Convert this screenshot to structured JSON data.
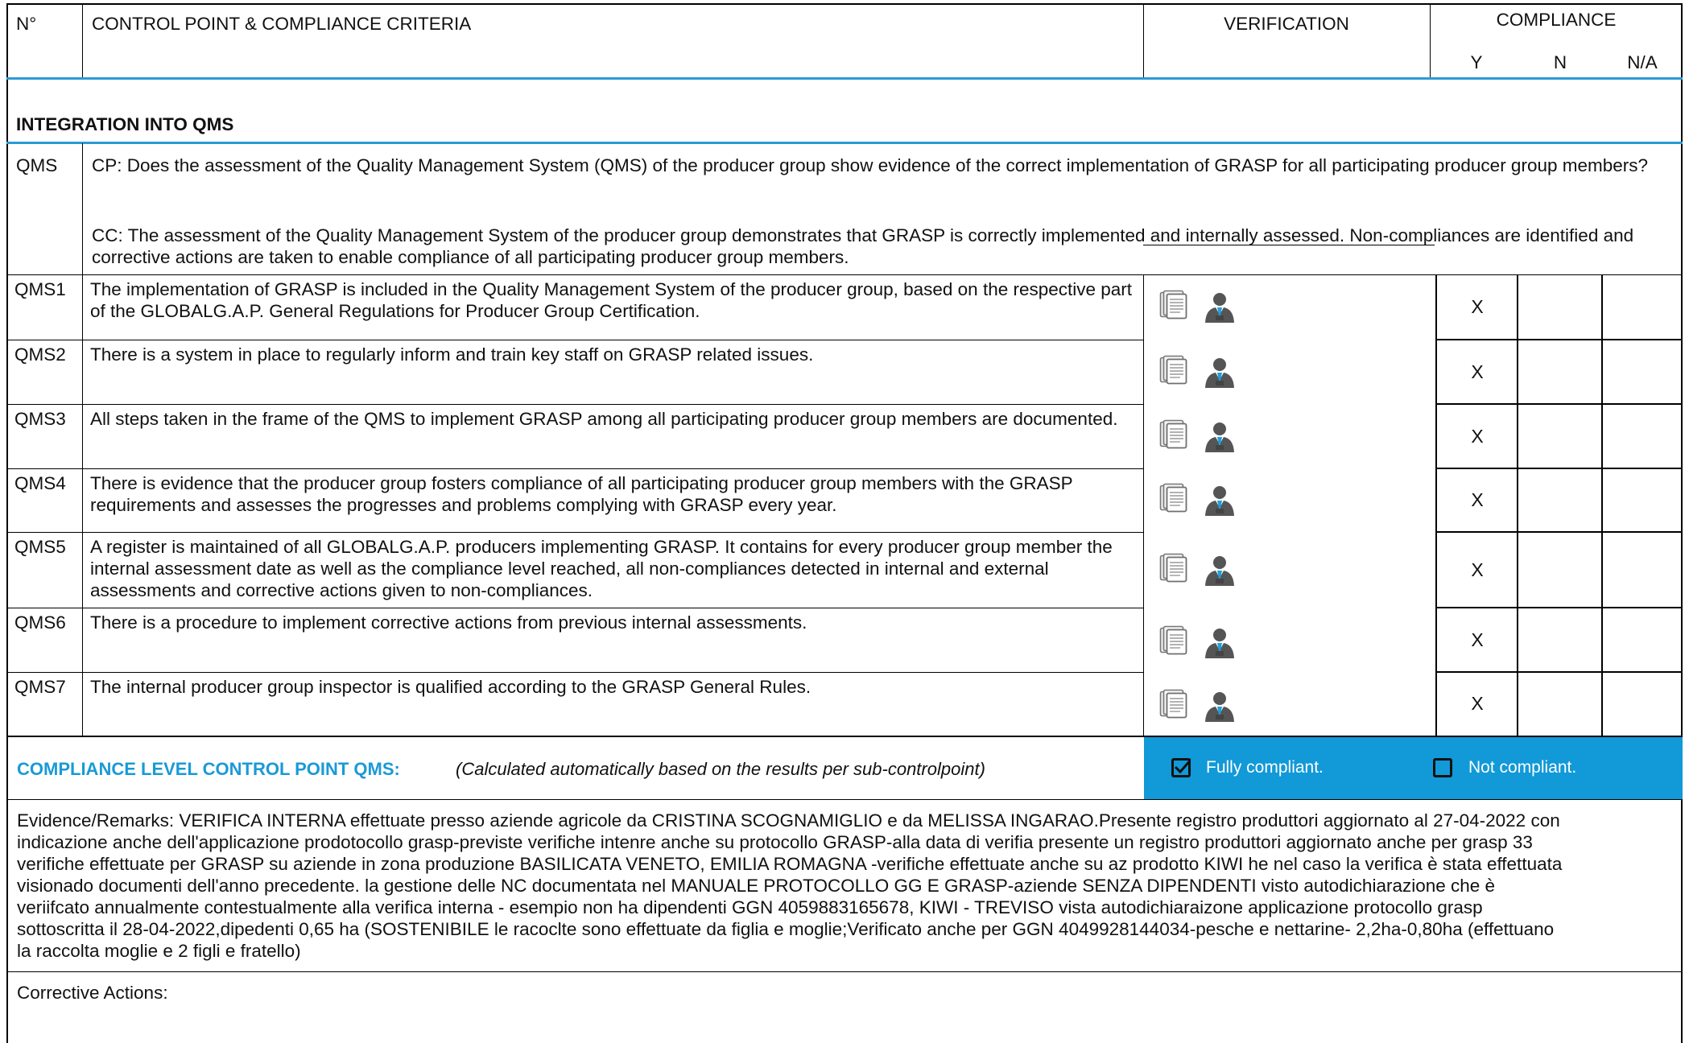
{
  "header": {
    "no": "N°",
    "criteria": "CONTROL POINT & COMPLIANCE CRITERIA",
    "verification": "VERIFICATION",
    "compliance": "COMPLIANCE",
    "y": "Y",
    "n": "N",
    "na": "N/A"
  },
  "section": {
    "title": "INTEGRATION INTO QMS"
  },
  "qms": {
    "code": "QMS",
    "cp": "CP: Does the assessment of the Quality Management System (QMS) of the producer group show evidence of the correct implementation of GRASP for all participating producer group members?",
    "cc": "CC: The assessment of the Quality Management System of the producer group demonstrates that GRASP is correctly implemented and internally assessed. Non-compliances are identified and corrective actions are taken to enable compliance of all participating producer group members."
  },
  "rows": [
    {
      "code": "QMS1",
      "text": "The implementation of GRASP is included in the Quality Management System of the producer group, based on the respective part of the GLOBALG.A.P. General Regulations for Producer Group Certification.",
      "y": "X",
      "n": "",
      "na": ""
    },
    {
      "code": "QMS2",
      "text": "There is a system in place to regularly inform and train key staff on GRASP related issues.",
      "y": "X",
      "n": "",
      "na": ""
    },
    {
      "code": "QMS3",
      "text": "All steps taken in the frame of the QMS to implement GRASP among all participating producer group members are documented.",
      "y": "X",
      "n": "",
      "na": ""
    },
    {
      "code": "QMS4",
      "text": "There is evidence that the producer group fosters compliance of all participating producer group members with the GRASP requirements and assesses the progresses and problems complying with GRASP every year.",
      "y": "X",
      "n": "",
      "na": ""
    },
    {
      "code": "QMS5",
      "text": "A register is maintained of all GLOBALG.A.P. producers implementing GRASP. It contains for every producer group member the internal assessment date as well as the compliance level reached, all non-compliances detected in internal and external assessments and corrective actions given to non-compliances.",
      "y": "X",
      "n": "",
      "na": ""
    },
    {
      "code": "QMS6",
      "text": "There is a procedure to implement corrective actions from previous internal assessments.",
      "y": "X",
      "n": "",
      "na": ""
    },
    {
      "code": "QMS7",
      "text": "The internal producer group inspector is qualified according to the GRASP General Rules.",
      "y": "X",
      "n": "",
      "na": ""
    }
  ],
  "compliance_level": {
    "label": "COMPLIANCE LEVEL CONTROL POINT QMS:",
    "note": "(Calculated automatically based on the results per sub-controlpoint)",
    "fully": "Fully compliant.",
    "not": "Not compliant.",
    "fully_checked": true,
    "not_checked": false
  },
  "evidence": {
    "lines": [
      "Evidence/Remarks: VERIFICA INTERNA effettuate presso aziende agricole da CRISTINA SCOGNAMIGLIO e da MELISSA INGARAO.Presente registro produttori aggiornato al 27-04-2022 con",
      "indicazione anche dell'applicazione prodotocollo grasp-previste verifiche intenre anche su protocollo GRASP-alla data di verifia  presente un registro produttori aggiornato anche per grasp 33",
      "verifiche effettuate per GRASP su aziende in zona produzione BASILICATA VENETO, EMILIA ROMAGNA -verifiche effettuate anche su az prodotto KIWI he nel caso la verifica è stata effettuata",
      "visionado documenti dell'anno precedente. la gestione delle NC documentata nel MANUALE PROTOCOLLO GG E GRASP-aziende SENZA DIPENDENTI visto autodichiarazione che è",
      "veriifcato annualmente contestualmente alla verifica interna - esempio non ha dipendenti GGN 4059883165678, KIWI - TREVISO vista autodichiaraizone applicazione protocollo grasp",
      "sottoscritta il 28-04-2022,dipedenti 0,65 ha (SOSTENIBILE le racoclte sono effettuate da figlia e moglie;Verificato anche per GGN 4049928144034-pesche e nettarine- 2,2ha-0,80ha (effettuano",
      "la raccolta moglie e 2 figli e fratello)"
    ]
  },
  "corrective": {
    "label": "Corrective Actions:"
  },
  "icons": {
    "document": "document-stack-icon",
    "inspector": "inspector-person-icon"
  }
}
